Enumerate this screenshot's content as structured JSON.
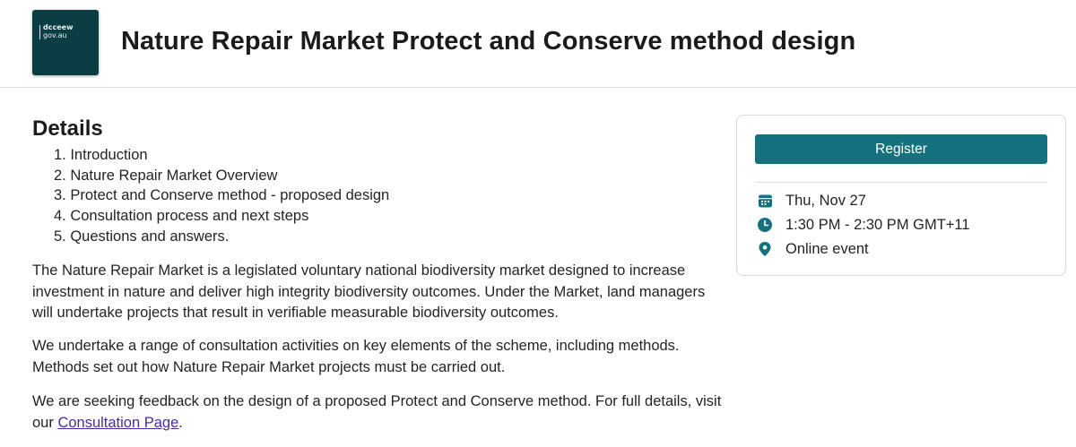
{
  "header": {
    "logo_line1": "dcceew",
    "logo_line2": "gov.au",
    "title": "Nature Repair Market Protect and Conserve method design"
  },
  "details": {
    "heading": "Details",
    "agenda": [
      "1. Introduction",
      "2. Nature Repair Market Overview",
      "3. Protect and Conserve method - proposed design",
      "4. Consultation process and next steps",
      "5. Questions and answers."
    ],
    "paragraph1": "The Nature Repair Market is a legislated voluntary national biodiversity market designed to increase investment in nature and deliver high integrity biodiversity outcomes. Under the Market, land managers will undertake projects that result in verifiable measurable biodiversity outcomes.",
    "paragraph2": "We undertake a range of consultation activities on key elements of the scheme, including methods. Methods set out how Nature Repair Market projects must be carried out.",
    "paragraph3_prefix": "We are seeking feedback on the design of a proposed Protect and Conserve method. For full details, visit our ",
    "paragraph3_link": "Consultation Page",
    "paragraph3_suffix": "."
  },
  "event_card": {
    "register_label": "Register",
    "date": "Thu, Nov 27",
    "time": "1:30 PM - 2:30 PM GMT+11",
    "location": "Online event",
    "icons": {
      "date": "calendar-icon",
      "time": "clock-icon",
      "location": "location-pin-icon"
    },
    "accent_color": "#16717e"
  }
}
